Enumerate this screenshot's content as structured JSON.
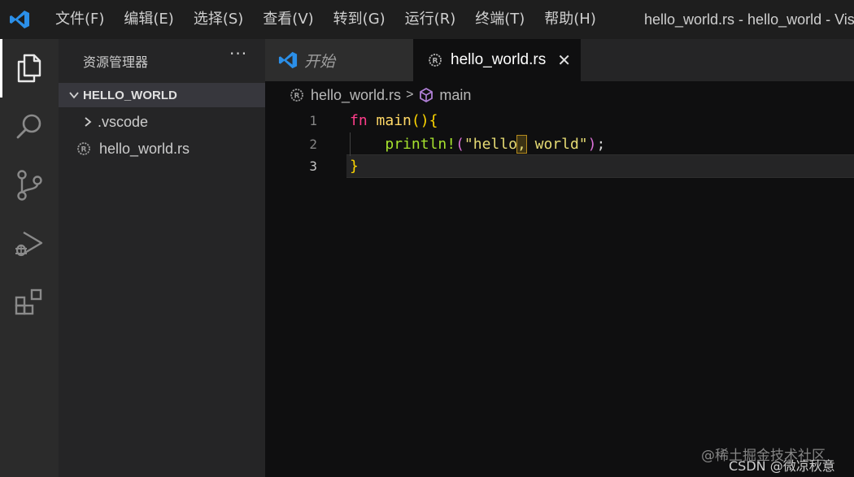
{
  "menu": [
    "文件(F)",
    "编辑(E)",
    "选择(S)",
    "查看(V)",
    "转到(G)",
    "运行(R)",
    "终端(T)",
    "帮助(H)"
  ],
  "window_title": "hello_world.rs - hello_world - Visual Studio Code",
  "colors": {
    "accent_blue": "#2b8fe8",
    "keyword": "#ff3d8b",
    "function": "#ffd866",
    "macro": "#a6e22e",
    "string": "#e6db74"
  },
  "activity_icons": [
    "explorer-icon",
    "search-icon",
    "source-control-icon",
    "run-debug-icon",
    "extensions-icon"
  ],
  "sidebar": {
    "title": "资源管理器",
    "more": "···",
    "folder": "HELLO_WORLD",
    "items": [
      {
        "label": ".vscode",
        "type": "folder"
      },
      {
        "label": "hello_world.rs",
        "type": "rust-file"
      }
    ]
  },
  "tabs": [
    {
      "label": "开始",
      "active": false
    },
    {
      "label": "hello_world.rs",
      "active": true,
      "close": "✕"
    }
  ],
  "breadcrumb": {
    "file": "hello_world.rs",
    "separator": ">",
    "symbol": "main"
  },
  "editor": {
    "line_numbers": [
      "1",
      "2",
      "3"
    ],
    "active_line": "3",
    "code": {
      "l1_kw": "fn",
      "l1_fn": "main",
      "l1_paren": "()",
      "l1_brace": "{",
      "l2_macro": "println!",
      "l2_open": "(",
      "l2_str_a": "\"hello",
      "l2_str_b": ",",
      "l2_str_c": " world\"",
      "l2_close": ")",
      "l2_semi": ";",
      "l3_brace": "}"
    }
  },
  "watermark": {
    "top": "@稀土掘金技术社区",
    "bottom": "CSDN @微凉秋意"
  }
}
